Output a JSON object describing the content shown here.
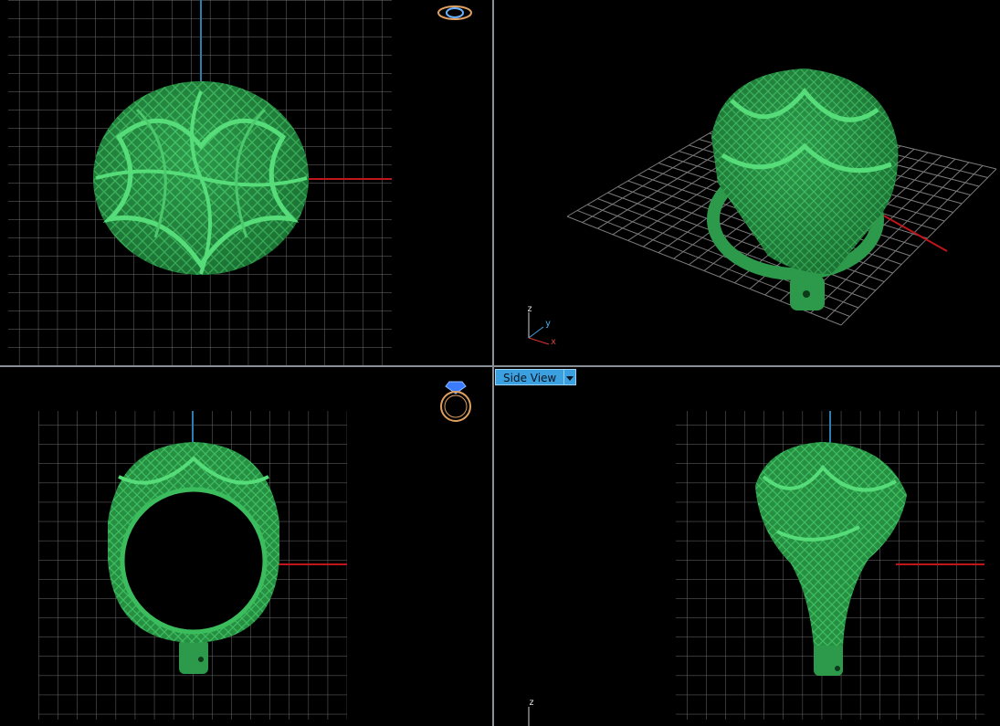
{
  "viewports": {
    "top_left": {
      "name": "top"
    },
    "top_right": {
      "name": "perspective"
    },
    "bottom_left": {
      "name": "front"
    },
    "bottom_right": {
      "name": "side",
      "label": "Side View"
    }
  },
  "axis": {
    "x": "x",
    "y": "y",
    "z": "z"
  },
  "colors": {
    "background": "#000000",
    "grid": "#7a7a7a",
    "model": "#2fa84f",
    "axis_red": "#c0151a",
    "axis_blue": "#2a7fb0",
    "label_bg": "#3aa0e0"
  },
  "icons": [
    "ring-top-view-icon",
    "ring-front-view-icon",
    "axis-triad-icon",
    "dropdown-arrow-icon"
  ]
}
